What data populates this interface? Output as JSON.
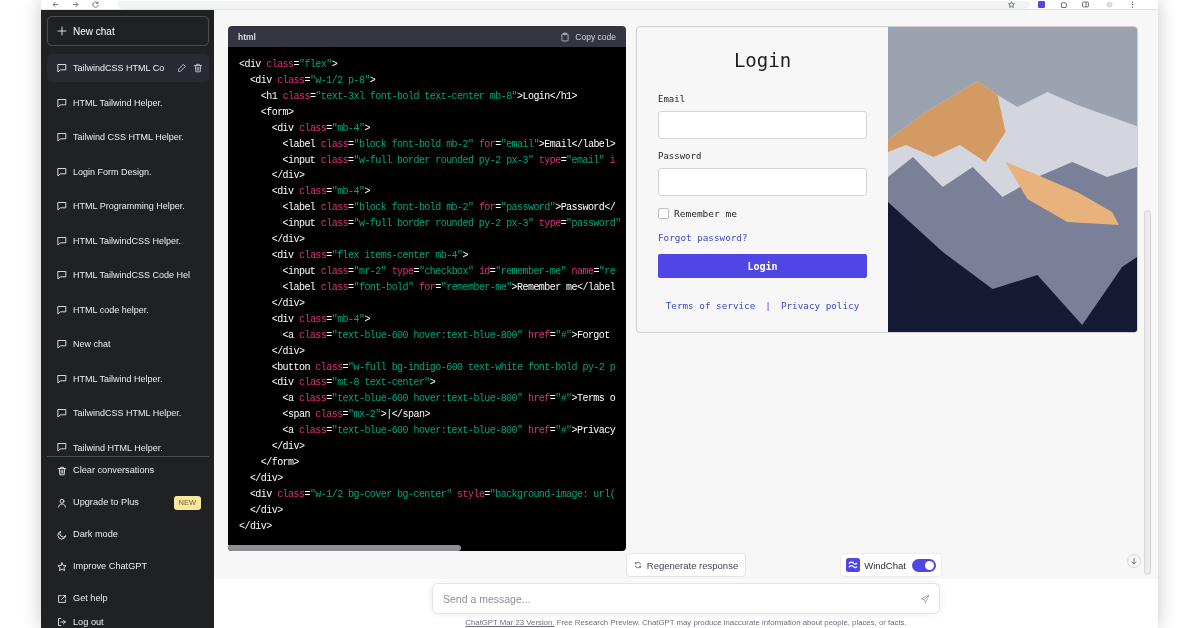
{
  "sidebar": {
    "new_chat": "New chat",
    "conversations": [
      {
        "title": "TailwindCSS HTML Co",
        "selected": true
      },
      {
        "title": "HTML Tailwind Helper.",
        "selected": false
      },
      {
        "title": "Tailwind CSS HTML Helper.",
        "selected": false
      },
      {
        "title": "Login Form Design.",
        "selected": false
      },
      {
        "title": "HTML Programming Helper.",
        "selected": false
      },
      {
        "title": "HTML TailwindCSS Helper.",
        "selected": false
      },
      {
        "title": "HTML TailwindCSS Code Hel",
        "selected": false
      },
      {
        "title": "HTML code helper.",
        "selected": false
      },
      {
        "title": "New chat",
        "selected": false
      },
      {
        "title": "HTML Tailwind Helper.",
        "selected": false
      },
      {
        "title": "TailwindCSS HTML Helper.",
        "selected": false
      },
      {
        "title": "Tailwind HTML Helper.",
        "selected": false
      }
    ],
    "menu": [
      {
        "label": "Clear conversations",
        "kind": "clear"
      },
      {
        "label": "Upgrade to Plus",
        "kind": "account",
        "badge": "NEW"
      },
      {
        "label": "Dark mode",
        "kind": "theme"
      },
      {
        "label": "Improve ChatGPT",
        "kind": "feedback"
      },
      {
        "label": "Get help",
        "kind": "help"
      },
      {
        "label": "Log out",
        "kind": "logout"
      }
    ]
  },
  "code_block": {
    "language": "html",
    "copy_label": "Copy code",
    "lines": [
      "<div class=\"flex\">",
      "  <div class=\"w-1/2 p-8\">",
      "    <h1 class=\"text-3xl font-bold text-center mb-8\">Login</h1>",
      "    <form>",
      "      <div class=\"mb-4\">",
      "        <label class=\"block font-bold mb-2\" for=\"email\">Email</label>",
      "        <input class=\"w-full border rounded py-2 px-3\" type=\"email\" i",
      "      </div>",
      "      <div class=\"mb-4\">",
      "        <label class=\"block font-bold mb-2\" for=\"password\">Password</",
      "        <input class=\"w-full border rounded py-2 px-3\" type=\"password\"",
      "      </div>",
      "      <div class=\"flex items-center mb-4\">",
      "        <input class=\"mr-2\" type=\"checkbox\" id=\"remember-me\" name=\"re",
      "        <label class=\"font-bold\" for=\"remember-me\">Remember me</label",
      "      </div>",
      "      <div class=\"mb-4\">",
      "        <a class=\"text-blue-600 hover:text-blue-800\" href=\"#\">Forgot",
      "      </div>",
      "      <button class=\"w-full bg-indigo-600 text-white font-bold py-2 p",
      "      <div class=\"mt-8 text-center\">",
      "        <a class=\"text-blue-600 hover:text-blue-800\" href=\"#\">Terms o",
      "        <span class=\"mx-2\">|</span>",
      "        <a class=\"text-blue-600 hover:text-blue-800\" href=\"#\">Privacy",
      "      </div>",
      "    </form>",
      "  </div>",
      "  <div class=\"w-1/2 bg-cover bg-center\" style=\"background-image: url(",
      "  </div>",
      "</div>"
    ]
  },
  "preview": {
    "title": "Login",
    "fields": [
      {
        "label": "Email"
      },
      {
        "label": "Password"
      }
    ],
    "remember": {
      "label": "Remember me",
      "checked": false
    },
    "forgot_link": "Forgot password?",
    "submit": "Login",
    "links": [
      "Terms of service",
      "Privacy policy"
    ],
    "separator": "|"
  },
  "actions": {
    "regenerate": "Regenerate response",
    "windchat": {
      "name": "WindChat",
      "on": true
    }
  },
  "composer": {
    "placeholder": "Send a message...",
    "disclaimer": {
      "link": "ChatGPT Mar 23 Version.",
      "text": " Free Research Preview. ChatGPT may produce inaccurate information about people, places, or facts."
    }
  }
}
